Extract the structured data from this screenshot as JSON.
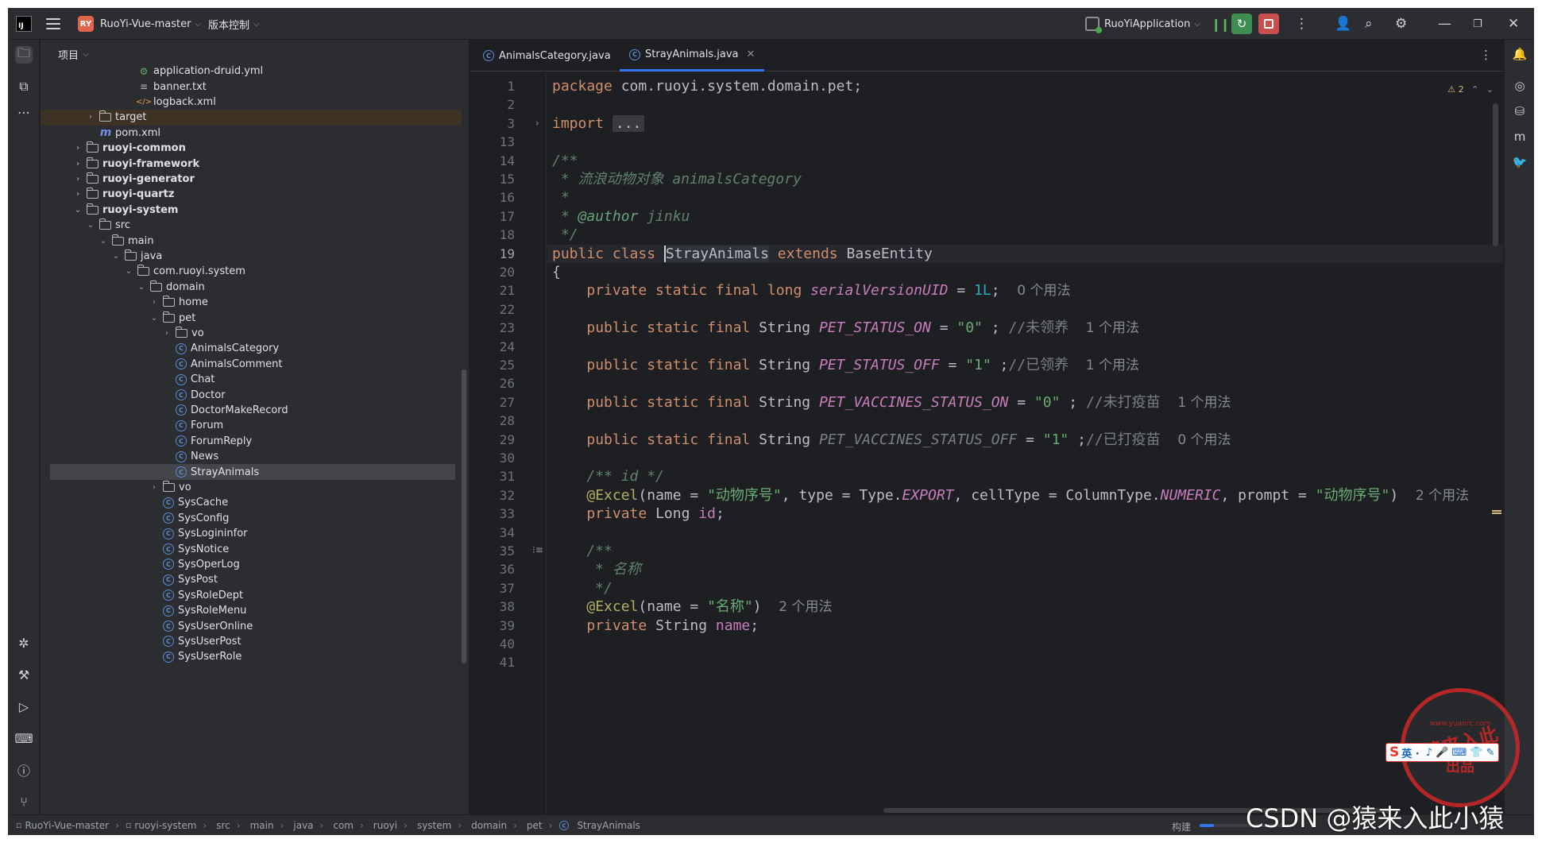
{
  "titlebar": {
    "project_badge": "RY",
    "project_name": "RuoYi-Vue-master",
    "vcs_label": "版本控制",
    "run_config": "RuoYiApplication"
  },
  "project_panel": {
    "title": "项目",
    "tree": [
      {
        "label": "application-druid.yml",
        "depth": 6,
        "icon": "yml-file-icon",
        "expanded": null
      },
      {
        "label": "banner.txt",
        "depth": 6,
        "icon": "text-file-icon",
        "expanded": null
      },
      {
        "label": "logback.xml",
        "depth": 6,
        "icon": "xml-file-icon",
        "expanded": null
      },
      {
        "label": "target",
        "depth": 3,
        "icon": "folder-icon",
        "expanded": false,
        "highlight": true
      },
      {
        "label": "pom.xml",
        "depth": 3,
        "icon": "maven-icon",
        "expanded": null
      },
      {
        "label": "ruoyi-common",
        "depth": 2,
        "icon": "module-folder-icon",
        "expanded": false,
        "bold": true
      },
      {
        "label": "ruoyi-framework",
        "depth": 2,
        "icon": "module-folder-icon",
        "expanded": false,
        "bold": true
      },
      {
        "label": "ruoyi-generator",
        "depth": 2,
        "icon": "module-folder-icon",
        "expanded": false,
        "bold": true
      },
      {
        "label": "ruoyi-quartz",
        "depth": 2,
        "icon": "module-folder-icon",
        "expanded": false,
        "bold": true
      },
      {
        "label": "ruoyi-system",
        "depth": 2,
        "icon": "module-folder-icon",
        "expanded": true,
        "bold": true
      },
      {
        "label": "src",
        "depth": 3,
        "icon": "folder-icon",
        "expanded": true
      },
      {
        "label": "main",
        "depth": 4,
        "icon": "folder-icon",
        "expanded": true
      },
      {
        "label": "java",
        "depth": 5,
        "icon": "source-folder-icon",
        "expanded": true
      },
      {
        "label": "com.ruoyi.system",
        "depth": 6,
        "icon": "package-icon",
        "expanded": true
      },
      {
        "label": "domain",
        "depth": 7,
        "icon": "package-icon",
        "expanded": true
      },
      {
        "label": "home",
        "depth": 8,
        "icon": "package-icon",
        "expanded": false
      },
      {
        "label": "pet",
        "depth": 8,
        "icon": "package-icon",
        "expanded": true
      },
      {
        "label": "vo",
        "depth": 9,
        "icon": "package-icon",
        "expanded": false
      },
      {
        "label": "AnimalsCategory",
        "depth": 9,
        "icon": "class-icon",
        "expanded": null
      },
      {
        "label": "AnimalsComment",
        "depth": 9,
        "icon": "class-icon",
        "expanded": null
      },
      {
        "label": "Chat",
        "depth": 9,
        "icon": "class-icon",
        "expanded": null
      },
      {
        "label": "Doctor",
        "depth": 9,
        "icon": "class-icon",
        "expanded": null
      },
      {
        "label": "DoctorMakeRecord",
        "depth": 9,
        "icon": "class-icon",
        "expanded": null
      },
      {
        "label": "Forum",
        "depth": 9,
        "icon": "class-icon",
        "expanded": null
      },
      {
        "label": "ForumReply",
        "depth": 9,
        "icon": "class-icon",
        "expanded": null
      },
      {
        "label": "News",
        "depth": 9,
        "icon": "class-icon",
        "expanded": null
      },
      {
        "label": "StrayAnimals",
        "depth": 9,
        "icon": "class-icon",
        "expanded": null,
        "selected": true
      },
      {
        "label": "vo",
        "depth": 8,
        "icon": "package-icon",
        "expanded": false
      },
      {
        "label": "SysCache",
        "depth": 8,
        "icon": "class-icon",
        "expanded": null
      },
      {
        "label": "SysConfig",
        "depth": 8,
        "icon": "class-icon",
        "expanded": null
      },
      {
        "label": "SysLogininfor",
        "depth": 8,
        "icon": "class-icon",
        "expanded": null
      },
      {
        "label": "SysNotice",
        "depth": 8,
        "icon": "class-icon",
        "expanded": null
      },
      {
        "label": "SysOperLog",
        "depth": 8,
        "icon": "class-icon",
        "expanded": null
      },
      {
        "label": "SysPost",
        "depth": 8,
        "icon": "class-icon",
        "expanded": null
      },
      {
        "label": "SysRoleDept",
        "depth": 8,
        "icon": "class-icon",
        "expanded": null
      },
      {
        "label": "SysRoleMenu",
        "depth": 8,
        "icon": "class-icon",
        "expanded": null
      },
      {
        "label": "SysUserOnline",
        "depth": 8,
        "icon": "class-icon",
        "expanded": null
      },
      {
        "label": "SysUserPost",
        "depth": 8,
        "icon": "class-icon",
        "expanded": null
      },
      {
        "label": "SysUserRole",
        "depth": 8,
        "icon": "class-icon",
        "expanded": null
      }
    ]
  },
  "editor": {
    "tabs": [
      {
        "label": "AnimalsCategory.java",
        "active": false
      },
      {
        "label": "StrayAnimals.java",
        "active": true
      }
    ],
    "warning_count": "2",
    "current_line": 19,
    "lines": [
      {
        "n": "1",
        "tokens": [
          [
            "kw",
            "package "
          ],
          [
            "p",
            "com.ruoyi.system.domain.pet;"
          ]
        ]
      },
      {
        "n": "2",
        "tokens": []
      },
      {
        "n": "3",
        "fold": true,
        "tokens": [
          [
            "kw",
            "import "
          ],
          [
            "foldbox",
            "..."
          ]
        ]
      },
      {
        "n": "13",
        "tokens": []
      },
      {
        "n": "14",
        "tokens": [
          [
            "doc",
            "/**"
          ]
        ]
      },
      {
        "n": "15",
        "tokens": [
          [
            "doc",
            " * 流浪动物对象 animalsCategory"
          ]
        ]
      },
      {
        "n": "16",
        "tokens": [
          [
            "doc",
            " *"
          ]
        ]
      },
      {
        "n": "17",
        "tokens": [
          [
            "doc",
            " * "
          ],
          [
            "doctag",
            "@author"
          ],
          [
            "doc",
            " jinku"
          ]
        ]
      },
      {
        "n": "18",
        "tokens": [
          [
            "doc",
            " */"
          ]
        ]
      },
      {
        "n": "19",
        "tokens": [
          [
            "kw",
            "public class "
          ],
          [
            "caret",
            "StrayAnimals"
          ],
          [
            "kw",
            " extends "
          ],
          [
            "p",
            "BaseEntity"
          ]
        ]
      },
      {
        "n": "20",
        "tokens": [
          [
            "p",
            "{"
          ]
        ]
      },
      {
        "n": "21",
        "tokens": [
          [
            "p",
            "    "
          ],
          [
            "kw",
            "private static final long "
          ],
          [
            "sf",
            "serialVersionUID"
          ],
          [
            "p",
            " = "
          ],
          [
            "num",
            "1L"
          ],
          [
            "p",
            ";  "
          ],
          [
            "inlay",
            "0 个用法"
          ]
        ]
      },
      {
        "n": "22",
        "tokens": []
      },
      {
        "n": "23",
        "tokens": [
          [
            "p",
            "    "
          ],
          [
            "kw",
            "public static final "
          ],
          [
            "p",
            "String "
          ],
          [
            "sf",
            "PET_STATUS_ON"
          ],
          [
            "p",
            " = "
          ],
          [
            "str",
            "\"0\""
          ],
          [
            "p",
            " ; "
          ],
          [
            "cmt",
            "//未领养"
          ],
          [
            "p",
            "  "
          ],
          [
            "inlay",
            "1 个用法"
          ]
        ]
      },
      {
        "n": "24",
        "tokens": []
      },
      {
        "n": "25",
        "tokens": [
          [
            "p",
            "    "
          ],
          [
            "kw",
            "public static final "
          ],
          [
            "p",
            "String "
          ],
          [
            "sf",
            "PET_STATUS_OFF"
          ],
          [
            "p",
            " = "
          ],
          [
            "str",
            "\"1\""
          ],
          [
            "p",
            " ;"
          ],
          [
            "cmt",
            "//已领养"
          ],
          [
            "p",
            "  "
          ],
          [
            "inlay",
            "1 个用法"
          ]
        ]
      },
      {
        "n": "26",
        "tokens": []
      },
      {
        "n": "27",
        "tokens": [
          [
            "p",
            "    "
          ],
          [
            "kw",
            "public static final "
          ],
          [
            "p",
            "String "
          ],
          [
            "sf",
            "PET_VACCINES_STATUS_ON"
          ],
          [
            "p",
            " = "
          ],
          [
            "str",
            "\"0\""
          ],
          [
            "p",
            " ; "
          ],
          [
            "cmt",
            "//未打疫苗"
          ],
          [
            "p",
            "  "
          ],
          [
            "inlay",
            "1 个用法"
          ]
        ]
      },
      {
        "n": "28",
        "tokens": []
      },
      {
        "n": "29",
        "tokens": [
          [
            "p",
            "    "
          ],
          [
            "kw",
            "public static final "
          ],
          [
            "p",
            "String "
          ],
          [
            "cm",
            "PET_VACCINES_STATUS_OFF"
          ],
          [
            "p",
            " = "
          ],
          [
            "str",
            "\"1\""
          ],
          [
            "p",
            " ;"
          ],
          [
            "cmt",
            "//已打疫苗"
          ],
          [
            "p",
            "  "
          ],
          [
            "inlay",
            "0 个用法"
          ]
        ]
      },
      {
        "n": "30",
        "tokens": []
      },
      {
        "n": "31",
        "tokens": [
          [
            "p",
            "    "
          ],
          [
            "doc",
            "/** id */"
          ]
        ]
      },
      {
        "n": "32",
        "tokens": [
          [
            "p",
            "    "
          ],
          [
            "ann",
            "@Excel"
          ],
          [
            "p",
            "(name = "
          ],
          [
            "str",
            "\"动物序号\""
          ],
          [
            "p",
            ", type = Type."
          ],
          [
            "sf",
            "EXPORT"
          ],
          [
            "p",
            ", cellType = ColumnType."
          ],
          [
            "sf",
            "NUMERIC"
          ],
          [
            "p",
            ", prompt = "
          ],
          [
            "str",
            "\"动物序号\""
          ],
          [
            "p",
            ")  "
          ],
          [
            "inlay",
            "2 个用法"
          ]
        ]
      },
      {
        "n": "33",
        "tokens": [
          [
            "p",
            "    "
          ],
          [
            "kw",
            "private "
          ],
          [
            "p",
            "Long "
          ],
          [
            "fld",
            "id"
          ],
          [
            "p",
            ";"
          ]
        ]
      },
      {
        "n": "34",
        "tokens": []
      },
      {
        "n": "35",
        "lens": true,
        "tokens": [
          [
            "p",
            "    "
          ],
          [
            "doc",
            "/**"
          ]
        ]
      },
      {
        "n": "36",
        "tokens": [
          [
            "doc",
            "     * 名称"
          ]
        ]
      },
      {
        "n": "37",
        "tokens": [
          [
            "doc",
            "     */"
          ]
        ]
      },
      {
        "n": "38",
        "tokens": [
          [
            "p",
            "    "
          ],
          [
            "ann",
            "@Excel"
          ],
          [
            "p",
            "(name = "
          ],
          [
            "str",
            "\"名称\""
          ],
          [
            "p",
            ")  "
          ],
          [
            "inlay",
            "2 个用法"
          ]
        ]
      },
      {
        "n": "39",
        "tokens": [
          [
            "p",
            "    "
          ],
          [
            "kw",
            "private "
          ],
          [
            "p",
            "String "
          ],
          [
            "fld",
            "name"
          ],
          [
            "p",
            ";"
          ]
        ]
      },
      {
        "n": "40",
        "tokens": []
      },
      {
        "n": "41",
        "tokens": []
      }
    ]
  },
  "statusbar": {
    "breadcrumbs": [
      "RuoYi-Vue-master",
      "ruoyi-system",
      "src",
      "main",
      "java",
      "com",
      "ruoyi",
      "system",
      "domain",
      "pet",
      "StrayAnimals"
    ],
    "build_label": "构建",
    "build_progress": 0.15
  },
  "watermarks": {
    "csdn": "CSDN @猿来入此小猿",
    "stamp_url": "www.yuanrc.com",
    "stamp_main": "猿来入此",
    "stamp_sub": "出品",
    "ime_logo": "S",
    "ime_text": "英 ·",
    "ime_icons": "♪ 🎤 ⌨ 👕 ✎"
  }
}
